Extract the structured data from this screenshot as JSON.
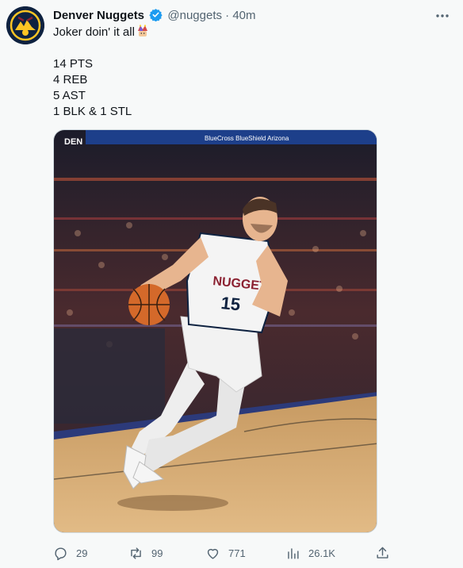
{
  "tweet": {
    "author_name": "Denver Nuggets",
    "handle": "@nuggets",
    "separator": "·",
    "time": "40m",
    "text_lines": [
      "Joker doin' it all",
      "",
      "14 PTS",
      "4 REB",
      "5 AST",
      "1 BLK & 1 STL"
    ],
    "emoji": "joker-emoji",
    "media": {
      "banner_text": "BlueCross BlueShield Arizona",
      "vertical_logo": "DEN",
      "jersey_text": "NUGGETS",
      "jersey_number": "15"
    },
    "actions": {
      "replies": "29",
      "retweets": "99",
      "likes": "771",
      "views": "26.1K"
    }
  },
  "colors": {
    "brand_navy": "#0e2240",
    "brand_gold": "#fec524",
    "brand_red": "#8b2131",
    "verified_blue": "#1d9bf0",
    "muted_text": "#536471"
  }
}
